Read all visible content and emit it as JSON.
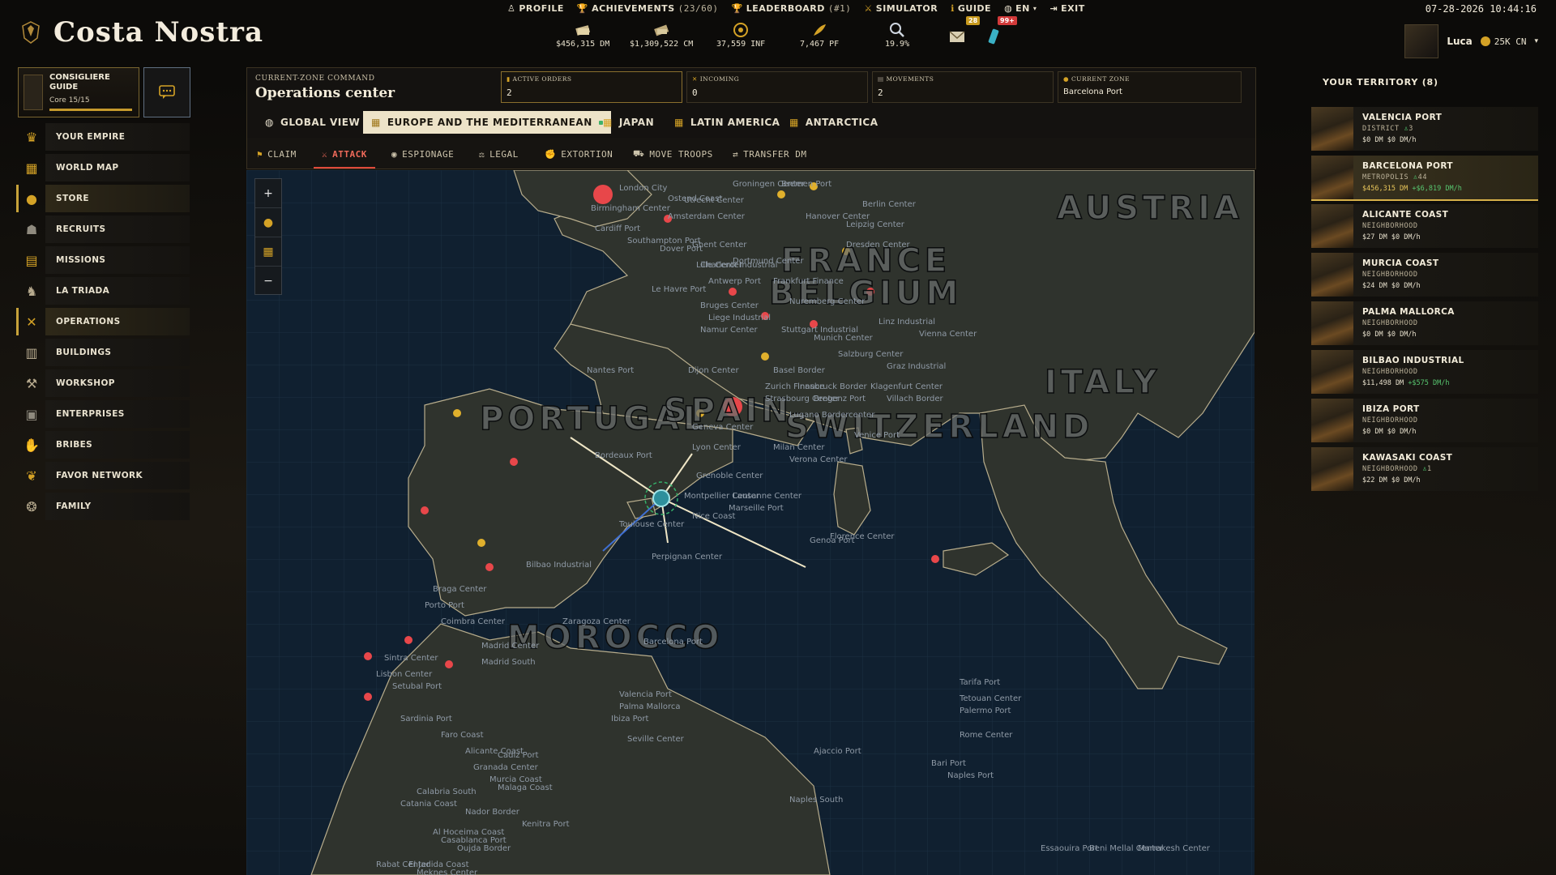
{
  "app": {
    "title": "Costa Nostra"
  },
  "topnav": [
    {
      "label": "PROFILE",
      "icon": "person-icon"
    },
    {
      "label": "ACHIEVEMENTS",
      "sub": "(23/60)",
      "icon": "trophy-icon"
    },
    {
      "label": "LEADERBOARD",
      "sub": "(#1)",
      "icon": "trophy-icon"
    },
    {
      "label": "SIMULATOR",
      "icon": "swords-icon"
    },
    {
      "label": "GUIDE",
      "icon": "info-icon"
    },
    {
      "label": "EN",
      "icon": "globe-icon"
    },
    {
      "label": "EXIT",
      "icon": "exit-icon"
    }
  ],
  "clock": "07-28-2026 10:44:16",
  "resources": [
    {
      "value": "$456,315 DM",
      "icon": "cash-stack-icon"
    },
    {
      "value": "$1,309,522 CM",
      "icon": "cash-bundle-icon"
    },
    {
      "value": "37,559 INF",
      "icon": "influence-icon"
    },
    {
      "value": "7,467 PF",
      "icon": "feather-icon"
    },
    {
      "value": "19.9%",
      "icon": "magnifier-icon"
    }
  ],
  "badges": {
    "messages": "28",
    "notifications": "99+"
  },
  "user": {
    "name": "Luca",
    "currency": "25K CN"
  },
  "guide": {
    "title": "CONSIGLIERE GUIDE",
    "subtitle": "Core 15/15"
  },
  "sidebar": {
    "items": [
      {
        "label": "YOUR EMPIRE",
        "icon": "crown-icon"
      },
      {
        "label": "WORLD MAP",
        "icon": "map-icon"
      },
      {
        "label": "STORE",
        "icon": "coin-icon"
      },
      {
        "label": "RECRUITS",
        "icon": "recruits-icon"
      },
      {
        "label": "MISSIONS",
        "icon": "scroll-icon"
      },
      {
        "label": "LA TRIADA",
        "icon": "dragon-icon"
      },
      {
        "label": "OPERATIONS",
        "icon": "crossed-swords-icon"
      },
      {
        "label": "BUILDINGS",
        "icon": "building-icon"
      },
      {
        "label": "WORKSHOP",
        "icon": "workbench-icon"
      },
      {
        "label": "ENTERPRISES",
        "icon": "enterprise-icon"
      },
      {
        "label": "BRIBES",
        "icon": "handshake-icon"
      },
      {
        "label": "FAVOR NETWORK",
        "icon": "favor-icon"
      },
      {
        "label": "FAMILY",
        "icon": "family-icon"
      }
    ]
  },
  "ops": {
    "label": "CURRENT-ZONE COMMAND",
    "title": "Operations center",
    "stats": [
      {
        "key": "ACTIVE ORDERS",
        "value": "2",
        "icon": "orders-icon"
      },
      {
        "key": "INCOMING",
        "value": "0",
        "icon": "incoming-icon"
      },
      {
        "key": "MOVEMENTS",
        "value": "2",
        "icon": "movements-icon"
      },
      {
        "key": "CURRENT ZONE",
        "value": "Barcelona Port",
        "icon": "zone-icon"
      }
    ]
  },
  "regions": [
    {
      "label": "GLOBAL VIEW",
      "icon": "globe-icon"
    },
    {
      "label": "EUROPE AND THE MEDITERRANEAN",
      "icon": "map-icon"
    },
    {
      "label": "JAPAN",
      "icon": "map-icon"
    },
    {
      "label": "LATIN AMERICA",
      "icon": "map-icon"
    },
    {
      "label": "ANTARCTICA",
      "icon": "map-icon"
    }
  ],
  "actions": [
    {
      "label": "CLAIM",
      "icon": "flag-icon"
    },
    {
      "label": "ATTACK",
      "icon": "sword-icon"
    },
    {
      "label": "ESPIONAGE",
      "icon": "eye-icon"
    },
    {
      "label": "LEGAL",
      "icon": "gavel-icon"
    },
    {
      "label": "EXTORTION",
      "icon": "fist-icon"
    },
    {
      "label": "MOVE TROOPS",
      "icon": "truck-icon"
    },
    {
      "label": "TRANSFER DM",
      "icon": "transfer-icon"
    }
  ],
  "map": {
    "countries": [
      "AUSTRIA",
      "FRANCE",
      "BELGIUM",
      "ITALY",
      "PORTUGAL",
      "SPAIN",
      "SWITZERLAND",
      "MOROCCO"
    ],
    "labels": [
      "Birmingham Center",
      "London City",
      "Ostend Coast",
      "Groningen Center",
      "Utrecht Center",
      "Amsterdam Center",
      "Bremen Port",
      "Hanover Center",
      "Berlin Center",
      "Leipzig Center",
      "Dresden Center",
      "Cardiff Port",
      "Southampton Port",
      "Dover Port",
      "Ghent Center",
      "Lille Center",
      "Dortmund Center",
      "Charleroi Industrial",
      "Antwerp Port",
      "Le Havre Port",
      "Frankfurt Finance",
      "Nuremberg Center",
      "Bruges Center",
      "Liege Industrial",
      "Namur Center",
      "Stuttgart Industrial",
      "Linz Industrial",
      "Vienna Center",
      "Munich Center",
      "Salzburg Center",
      "Graz Industrial",
      "Nantes Port",
      "Dijon Center",
      "Basel Border",
      "Zurich Finance",
      "Strasbourg Center",
      "Innsbruck Border",
      "Bregenz Port",
      "Klagenfurt Center",
      "Villach Border",
      "Lugano Bordercenter",
      "Geneva Center",
      "Lyon Center",
      "Milan Center",
      "Verona Center",
      "Venice Port",
      "Bordeaux Port",
      "Grenoble Center",
      "Montpellier Center",
      "Nice Coast",
      "Lausanne Center",
      "Marseille Port",
      "Genoa Port",
      "Florence Center",
      "Bilbao Industrial",
      "Toulouse Center",
      "Perpignan Center",
      "Braga Center",
      "Porto Port",
      "Coimbra Center",
      "Zaragoza Center",
      "Barcelona Port",
      "Madrid Center",
      "Madrid South",
      "Sintra Center",
      "Lisbon Center",
      "Setubal Port",
      "Valencia Port",
      "Palma Mallorca",
      "Ibiza Port",
      "Ajaccio Port",
      "Rome Center",
      "Bari Port",
      "Naples Port",
      "Naples South",
      "Sardinia Port",
      "Faro Coast",
      "Seville Center",
      "Alicante Coast",
      "Cadiz Port",
      "Granada Center",
      "Murcia Coast",
      "Malaga Coast",
      "Tarifa Port",
      "Tetouan Center",
      "Palermo Port",
      "Calabria South",
      "Catania Coast",
      "Nador Border",
      "Kenitra Port",
      "Al Hoceima Coast",
      "Oujda Border",
      "Casablanca Port",
      "Rabat Center",
      "Meknes Center",
      "El Jadida Coast",
      "Essaouira Port",
      "Beni Mellal Center",
      "Marrakesh Center"
    ]
  },
  "territory": {
    "title": "YOUR TERRITORY (8)",
    "items": [
      {
        "name": "VALENCIA PORT",
        "class": "DISTRICT",
        "pop": "3",
        "money": "$0 DM",
        "rate": "$0 DM/h"
      },
      {
        "name": "BARCELONA PORT",
        "class": "METROPOLIS",
        "pop": "44",
        "money": "$456,315 DM",
        "rate": "+$6,819 DM/h"
      },
      {
        "name": "ALICANTE COAST",
        "class": "NEIGHBORHOOD",
        "pop": "",
        "money": "$27 DM",
        "rate": "$0 DM/h"
      },
      {
        "name": "MURCIA COAST",
        "class": "NEIGHBORHOOD",
        "pop": "",
        "money": "$24 DM",
        "rate": "$0 DM/h"
      },
      {
        "name": "PALMA MALLORCA",
        "class": "NEIGHBORHOOD",
        "pop": "",
        "money": "$0 DM",
        "rate": "$0 DM/h"
      },
      {
        "name": "BILBAO INDUSTRIAL",
        "class": "NEIGHBORHOOD",
        "pop": "",
        "money": "$11,498 DM",
        "rate": "+$575 DM/h"
      },
      {
        "name": "IBIZA PORT",
        "class": "NEIGHBORHOOD",
        "pop": "",
        "money": "$0 DM",
        "rate": "$0 DM/h"
      },
      {
        "name": "KAWASAKI COAST",
        "class": "NEIGHBORHOOD",
        "pop": "1",
        "money": "$22 DM",
        "rate": "$0 DM/h"
      }
    ]
  },
  "colors": {
    "accent": "#c7a23a",
    "enemy": "#e8474a",
    "ally": "#e0b02c",
    "own": "#4a7fd6",
    "route": "#efe6c6"
  }
}
